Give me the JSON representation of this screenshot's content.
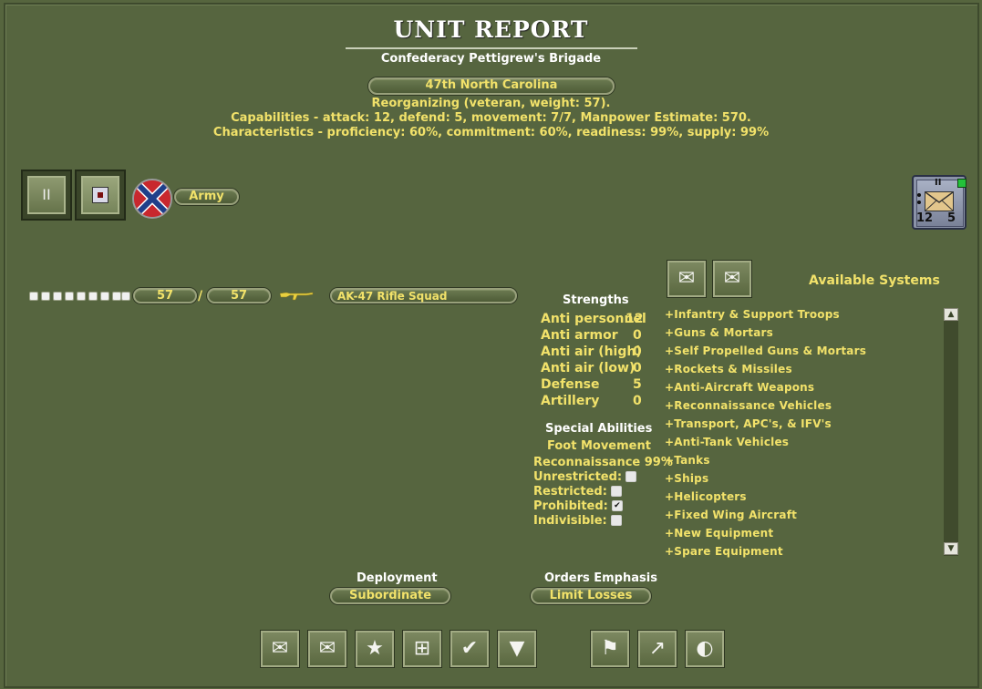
{
  "header": {
    "title": "UNIT REPORT",
    "formation": "Confederacy Pettigrew's Brigade",
    "unit_name": "47th North Carolina",
    "status": "Reorganizing (veteran, weight: 57).",
    "capabilities": "Capabilities - attack: 12, defend: 5, movement: 7/7, Manpower Estimate: 570.",
    "characteristics": "Characteristics - proficiency: 60%, commitment: 60%, readiness: 99%, supply: 99%"
  },
  "toolbar_top": {
    "pause_icon": "pause-icon",
    "pause_symbol": "II",
    "unit_symbol_icon": "unit-symbol-icon",
    "flag_icon": "confederate-flag-icon",
    "branch_label": "Army"
  },
  "counter": {
    "size_mark": "II",
    "left_value": "12",
    "right_value": "5",
    "icon": "hq-envelope-icon"
  },
  "squad": {
    "current": "57",
    "separator": "/",
    "max": "57",
    "weapon_icon": "rifle-icon",
    "name": "AK-47 Rifle Squad",
    "strength_fraction": 1.0
  },
  "strengths": {
    "heading": "Strengths",
    "rows": [
      {
        "label": "Anti personnel",
        "value": "12"
      },
      {
        "label": "Anti armor",
        "value": "0"
      },
      {
        "label": "Anti air (high)",
        "value": "0"
      },
      {
        "label": "Anti air (low)",
        "value": "0"
      },
      {
        "label": "Defense",
        "value": "5"
      },
      {
        "label": "Artillery",
        "value": "0"
      }
    ]
  },
  "special": {
    "heading": "Special Abilities",
    "movement": "Foot Movement",
    "recon": "Reconnaissance 99%",
    "unrestricted": "Unrestricted:",
    "restricted": "Restricted:",
    "prohibited": "Prohibited:",
    "indivisible": "Indivisible:",
    "checked_mark": "✔"
  },
  "systems": {
    "heading": "Available Systems",
    "items": [
      "+Infantry & Support Troops",
      "+Guns & Mortars",
      "+Self Propelled Guns & Mortars",
      "+Rockets & Missiles",
      "+Anti-Aircraft Weapons",
      "+Reconnaissance Vehicles",
      "+Transport, APC's, & IFV's",
      "+Anti-Tank Vehicles",
      "+Tanks",
      "+Ships",
      "+Helicopters",
      "+Fixed Wing Aircraft",
      "+New Equipment",
      "+Spare Equipment"
    ],
    "scroll_up": "▲",
    "scroll_down": "▼"
  },
  "deployment": {
    "label": "Deployment",
    "value": "Subordinate"
  },
  "orders": {
    "label": "Orders Emphasis",
    "value": "Limit Losses"
  },
  "bottom_icons": {
    "receive": "✉",
    "send": "✉",
    "star": "★",
    "org": "⊞",
    "check": "✔",
    "down": "▼",
    "flag": "⚑",
    "chart": "↗",
    "half": "◐"
  }
}
